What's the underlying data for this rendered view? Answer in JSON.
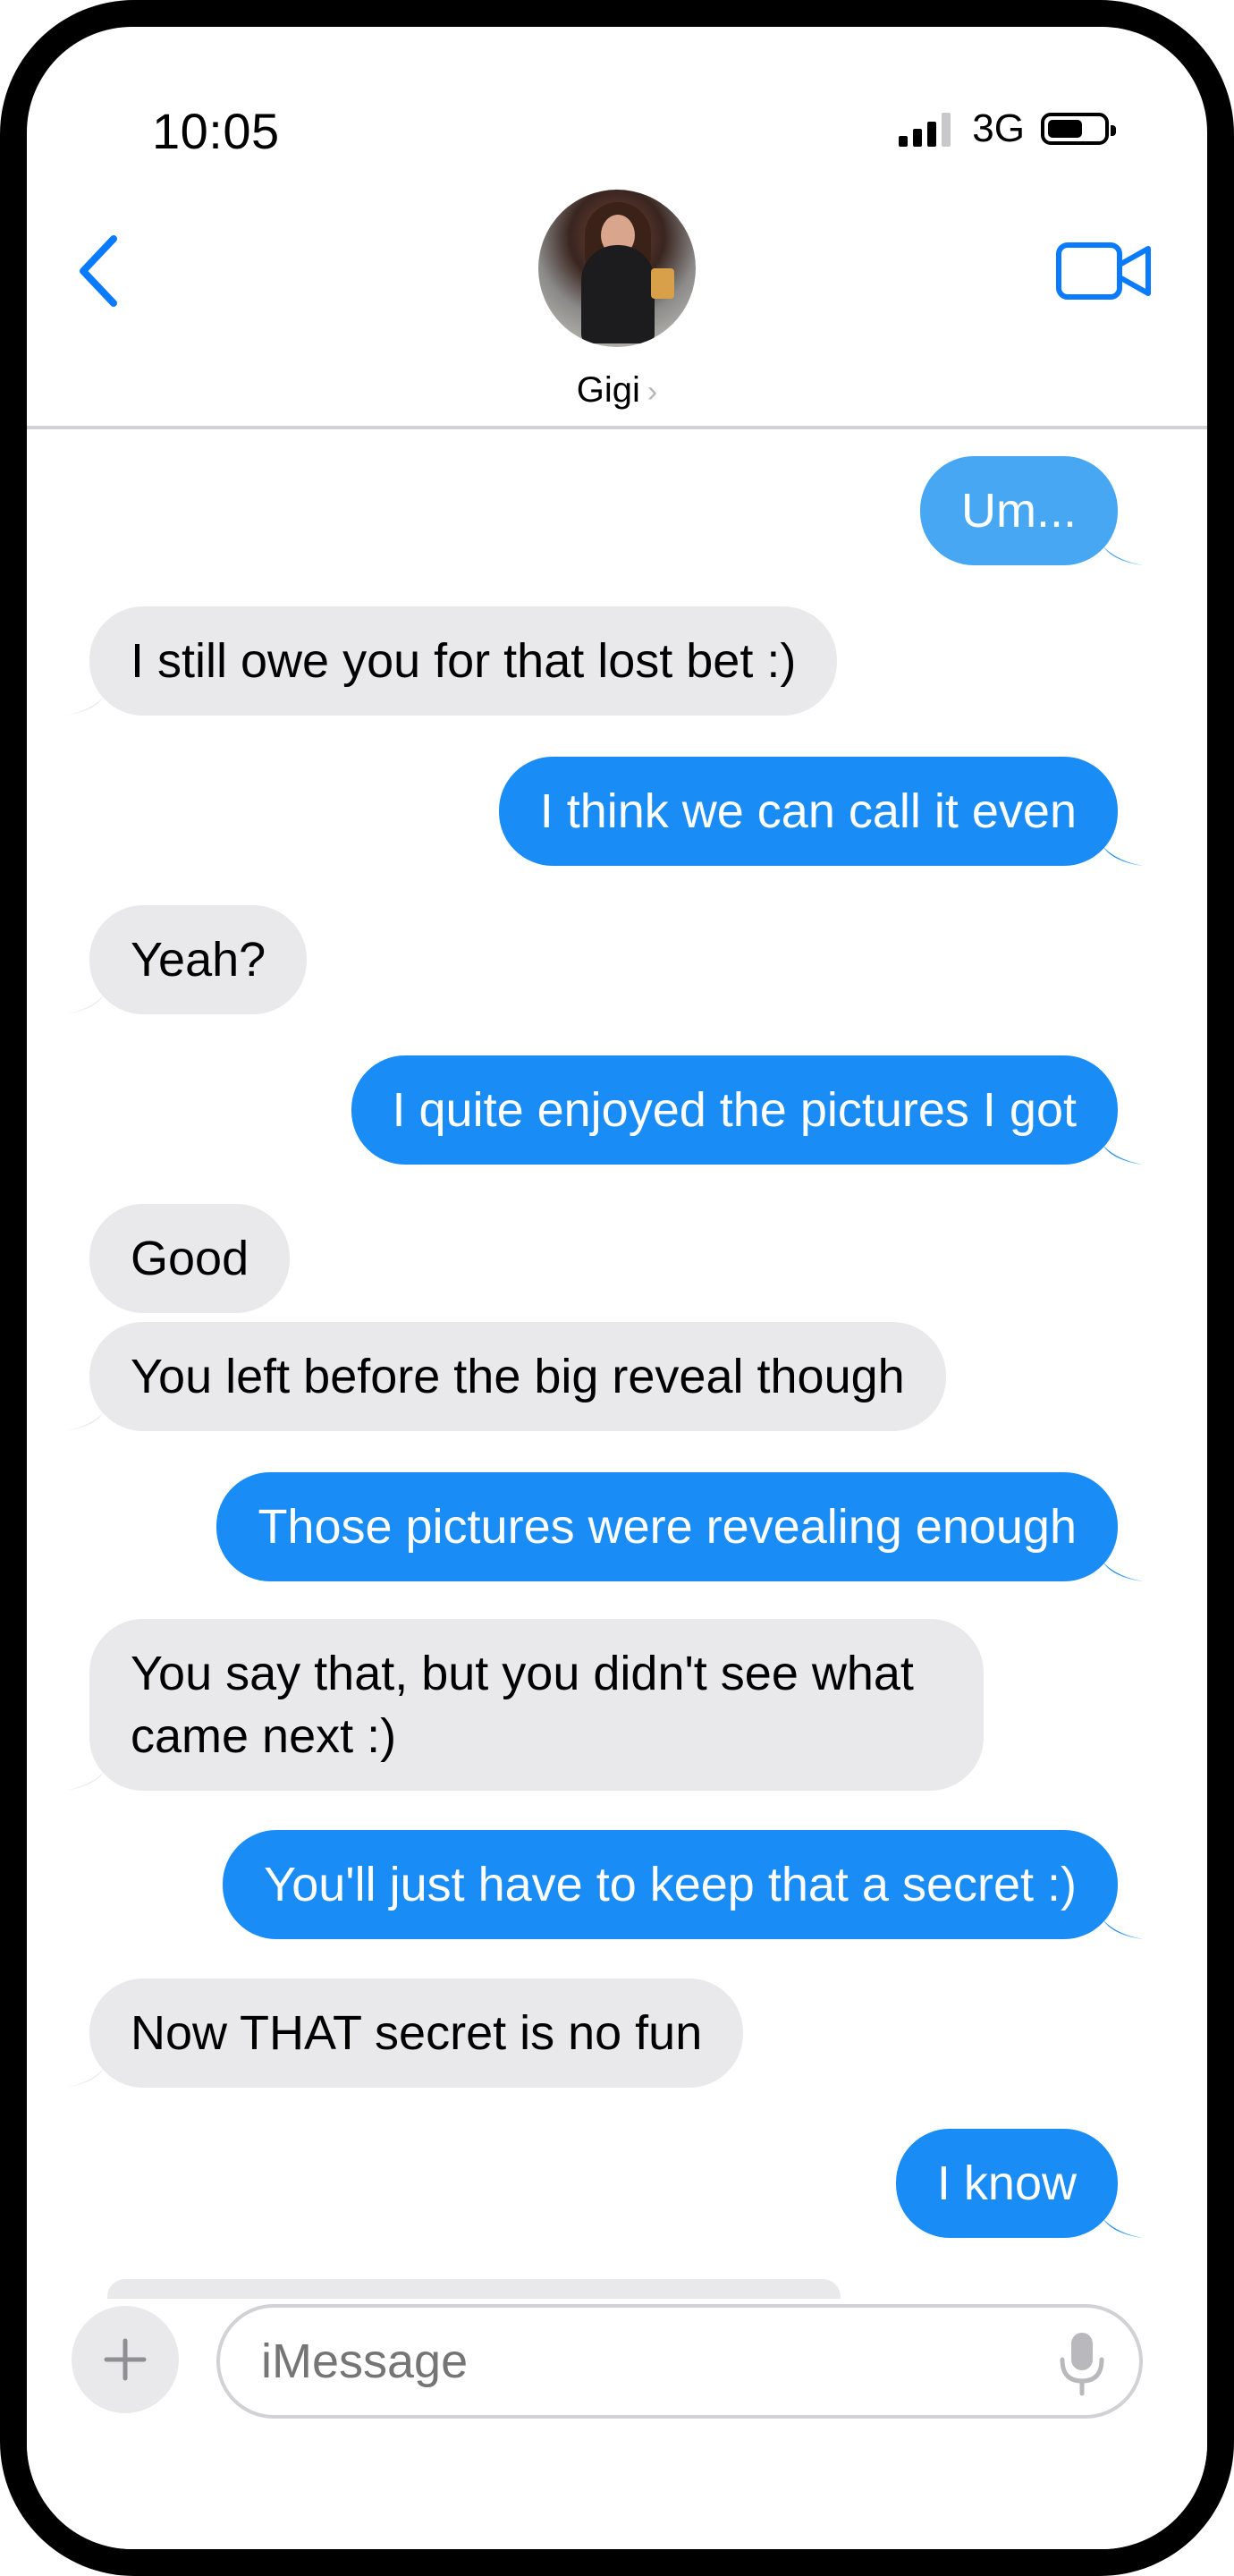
{
  "status_bar": {
    "time": "10:05",
    "network": "3G"
  },
  "header": {
    "contact_name": "Gigi",
    "chevron": "›"
  },
  "colors": {
    "sent_bubble": "#1a8cf5",
    "received_bubble": "#e9e9eb",
    "accent": "#0a7aff"
  },
  "icons": [
    "back-chevron-icon",
    "video-camera-icon",
    "plus-icon",
    "microphone-icon"
  ],
  "messages": [
    {
      "dir": "out",
      "text": "Um..."
    },
    {
      "dir": "in",
      "text": "I still owe you for that lost bet :)"
    },
    {
      "dir": "out",
      "text": "I think we can call it even"
    },
    {
      "dir": "in",
      "text": "Yeah?"
    },
    {
      "dir": "out",
      "text": "I quite enjoyed the pictures I got"
    },
    {
      "dir": "in",
      "text": "Good"
    },
    {
      "dir": "in",
      "text": "You left before the big reveal though"
    },
    {
      "dir": "out",
      "text": "Those pictures were revealing enough"
    },
    {
      "dir": "in",
      "text": "You say that, but you didn't see what came next :)"
    },
    {
      "dir": "out",
      "text": "You'll just have to keep that a secret :)"
    },
    {
      "dir": "in",
      "text": "Now THAT secret is no fun"
    },
    {
      "dir": "out",
      "text": "I know"
    }
  ],
  "composer": {
    "placeholder": "iMessage"
  }
}
